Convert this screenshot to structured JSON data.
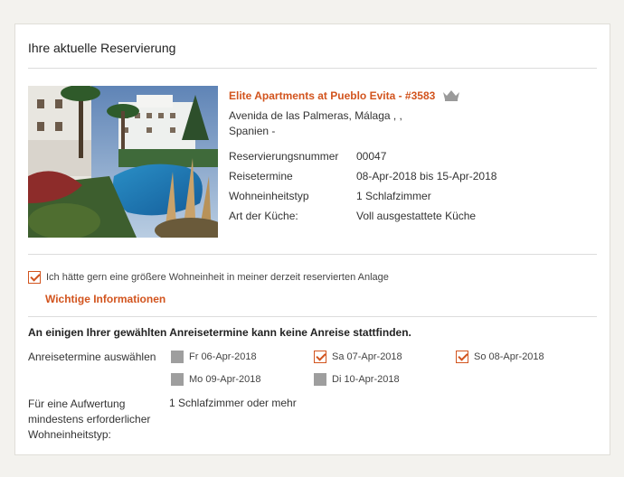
{
  "section_title": "Ihre aktuelle Reservierung",
  "hotel": {
    "name": "Elite Apartments at Pueblo Evita - #3583",
    "address_line1": "Avenida de las Palmeras, Málaga ,  ,",
    "address_line2": "Spanien  -"
  },
  "details": [
    {
      "label": "Reservierungsnummer",
      "value": "00047"
    },
    {
      "label": "Reisetermine",
      "value": "08-Apr-2018 bis 15-Apr-2018"
    },
    {
      "label": "Wohneinheitstyp",
      "value": "1  Schlafzimmer"
    },
    {
      "label": "Art der Küche:",
      "value": "Voll ausgestattete Küche"
    }
  ],
  "upgrade_checkbox": {
    "label": "Ich hätte gern eine größere Wohneinheit in meiner derzeit reservierten Anlage",
    "checked": true
  },
  "info_link": "Wichtige Informationen",
  "warning": "An einigen Ihrer gewählten Anreisetermine kann keine Anreise stattfinden.",
  "arrival": {
    "label": "Anreisetermine auswählen",
    "dates": [
      {
        "label": "Fr 06-Apr-2018",
        "state": "disabled"
      },
      {
        "label": "Sa 07-Apr-2018",
        "state": "checked"
      },
      {
        "label": "So 08-Apr-2018",
        "state": "checked"
      },
      {
        "label": "Mo 09-Apr-2018",
        "state": "disabled"
      },
      {
        "label": "Di 10-Apr-2018",
        "state": "disabled"
      }
    ]
  },
  "min_unit": {
    "label": "Für eine Aufwertung mindestens erforderlicher Wohneinheitstyp:",
    "value": "1  Schlafzimmer oder mehr"
  },
  "colors": {
    "accent": "#d2541e",
    "disabled": "#9e9e9e"
  }
}
